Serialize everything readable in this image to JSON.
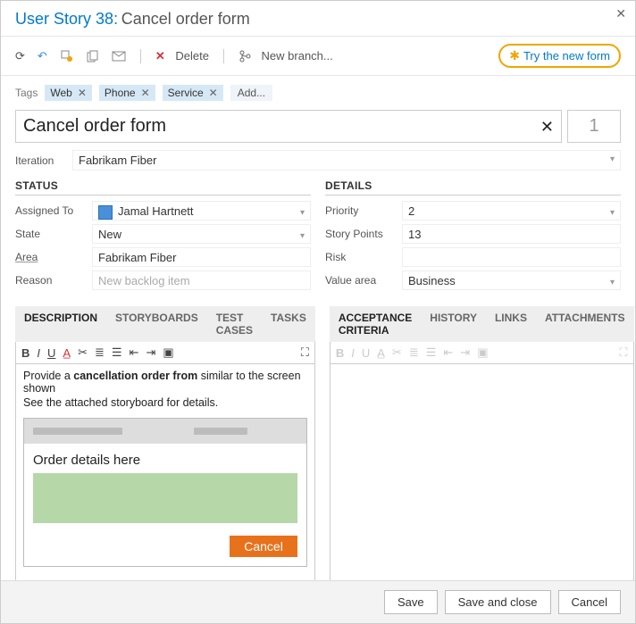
{
  "header": {
    "type_label": "User Story",
    "id": "38",
    "title": "Cancel order form"
  },
  "toolbar": {
    "delete_label": "Delete",
    "new_branch_label": "New branch...",
    "try_new_label": "Try the new form"
  },
  "tags": {
    "label": "Tags",
    "items": [
      "Web",
      "Phone",
      "Service"
    ],
    "add_label": "Add..."
  },
  "form": {
    "title": "Cancel order form",
    "effort": "1",
    "iteration_label": "Iteration",
    "iteration_value": "Fabrikam Fiber"
  },
  "status": {
    "header": "STATUS",
    "assigned_to": {
      "label": "Assigned To",
      "value": "Jamal Hartnett"
    },
    "state": {
      "label": "State",
      "value": "New"
    },
    "area": {
      "label": "Area",
      "value": "Fabrikam Fiber"
    },
    "reason": {
      "label": "Reason",
      "value": "New backlog item"
    }
  },
  "details": {
    "header": "DETAILS",
    "priority": {
      "label": "Priority",
      "value": "2"
    },
    "story_points": {
      "label": "Story Points",
      "value": "13"
    },
    "risk": {
      "label": "Risk",
      "value": ""
    },
    "value_area": {
      "label": "Value area",
      "value": "Business"
    }
  },
  "left_tabs": {
    "items": [
      "DESCRIPTION",
      "STORYBOARDS",
      "TEST CASES",
      "TASKS"
    ],
    "active": 0
  },
  "right_tabs": {
    "items": [
      "ACCEPTANCE CRITERIA",
      "HISTORY",
      "LINKS",
      "ATTACHMENTS"
    ],
    "active": 0
  },
  "description": {
    "line1_a": "Provide a ",
    "line1_b": "cancellation order from",
    "line1_c": " similar to the screen shown",
    "line2": "See the attached storyboard for details.",
    "mock_title": "Order details here",
    "mock_cancel": "Cancel"
  },
  "footer": {
    "save": "Save",
    "save_close": "Save and close",
    "cancel": "Cancel"
  }
}
